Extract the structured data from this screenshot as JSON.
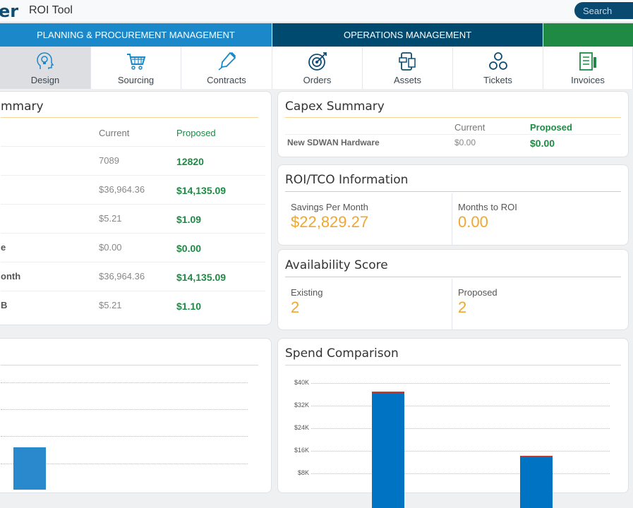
{
  "header": {
    "logo_text": "er",
    "app_title": "ROI Tool",
    "search_placeholder": "Search"
  },
  "nav": {
    "sections": [
      {
        "label": "PLANNING & PROCUREMENT MANAGEMENT",
        "color": "#1b88c9"
      },
      {
        "label": "OPERATIONS MANAGEMENT",
        "color": "#004a70"
      },
      {
        "label": "",
        "color": "#1e8a44"
      }
    ],
    "items": [
      {
        "label": "Design",
        "icon": "lightbulb-head-icon",
        "active": true
      },
      {
        "label": "Sourcing",
        "icon": "shopping-cart-icon"
      },
      {
        "label": "Contracts",
        "icon": "pen-icon"
      },
      {
        "label": "Orders",
        "icon": "target-icon"
      },
      {
        "label": "Assets",
        "icon": "assets-icon"
      },
      {
        "label": "Tickets",
        "icon": "people-network-icon"
      },
      {
        "label": "Invoices",
        "icon": "invoice-icon"
      }
    ]
  },
  "summary": {
    "title": "mmary",
    "col_current": "Current",
    "col_proposed": "Proposed",
    "rows": [
      {
        "label": "",
        "current": "7089",
        "proposed": "12820"
      },
      {
        "label": "",
        "current": "$36,964.36",
        "proposed": "$14,135.09"
      },
      {
        "label": "",
        "current": "$5.21",
        "proposed": "$1.09"
      },
      {
        "label": "e",
        "current": "$0.00",
        "proposed": "$0.00"
      },
      {
        "label": "onth",
        "current": "$36,964.36",
        "proposed": "$14,135.09"
      },
      {
        "label": "B",
        "current": "$5.21",
        "proposed": "$1.10"
      }
    ]
  },
  "capex": {
    "title": "Capex Summary",
    "col_current": "Current",
    "col_proposed": "Proposed",
    "rows": [
      {
        "label": "New SDWAN Hardware",
        "current": "$0.00",
        "proposed": "$0.00"
      }
    ]
  },
  "roi": {
    "title": "ROI/TCO Information",
    "savings_label": "Savings Per Month",
    "savings_value": "$22,829.27",
    "months_label": "Months to ROI",
    "months_value": "0.00"
  },
  "availability": {
    "title": "Availability Score",
    "existing_label": "Existing",
    "existing_value": "2",
    "proposed_label": "Proposed",
    "proposed_value": "2"
  },
  "chart_data": {
    "type": "bar",
    "title": "Spend Comparison",
    "ylim": [
      0,
      40000
    ],
    "yticks": [
      "$8K",
      "$16K",
      "$24K",
      "$32K",
      "$40K"
    ],
    "ytick_values": [
      8000,
      16000,
      24000,
      32000,
      40000
    ],
    "grid": true,
    "series": [
      {
        "values": [
          36964.36,
          14135.09
        ],
        "color": "#0073c2"
      }
    ],
    "cap_color": "#c0392b"
  }
}
